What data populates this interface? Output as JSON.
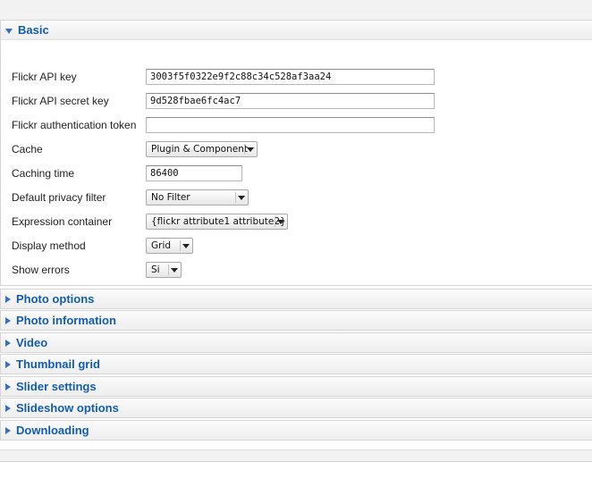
{
  "basic": {
    "title": "Basic",
    "fields": {
      "api_key": {
        "label": "Flickr API key",
        "value": "3003f5f0322e9f2c88c34c528af3aa24"
      },
      "api_secret": {
        "label": "Flickr API secret key",
        "value": "9d528fbae6fc4ac7"
      },
      "auth_token": {
        "label": "Flickr authentication token",
        "value": ""
      },
      "cache": {
        "label": "Cache",
        "value": "Plugin & Component"
      },
      "caching_time": {
        "label": "Caching time",
        "value": "86400"
      },
      "privacy": {
        "label": "Default privacy filter",
        "value": "No Filter"
      },
      "expression": {
        "label": "Expression container",
        "value": "{flickr attribute1 attribute2}"
      },
      "display": {
        "label": "Display method",
        "value": "Grid"
      },
      "errors": {
        "label": "Show errors",
        "value": "Si"
      }
    }
  },
  "sections": [
    {
      "title": "Photo options"
    },
    {
      "title": "Photo information"
    },
    {
      "title": "Video"
    },
    {
      "title": "Thumbnail grid"
    },
    {
      "title": "Slider settings"
    },
    {
      "title": "Slideshow options"
    },
    {
      "title": "Downloading"
    }
  ],
  "colors": {
    "accent": "#135cae",
    "triangle": "#3d6fb5"
  }
}
